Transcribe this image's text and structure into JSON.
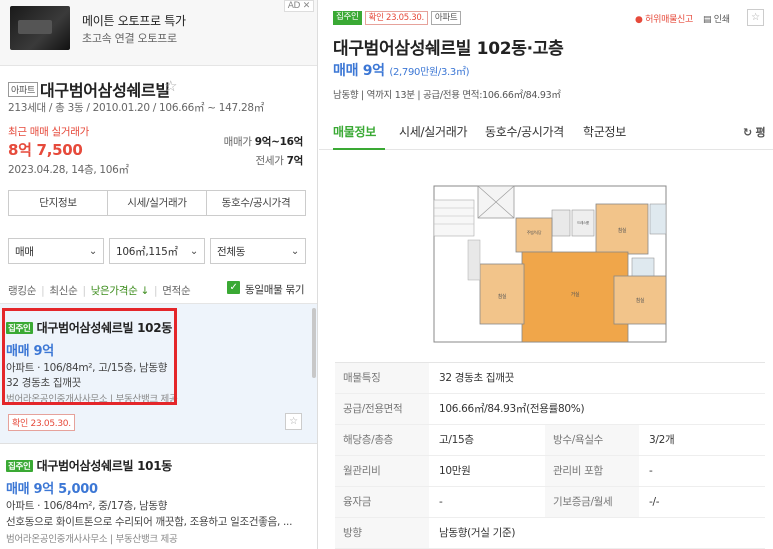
{
  "ad": {
    "title": "메이튼 오토프로 특가",
    "subtitle": "초고속 연결 오토프로",
    "badge": "AD ✕"
  },
  "complex": {
    "type_tag": "아파트",
    "name": "대구범어삼성쉐르빌",
    "star": "☆",
    "info": "213세대 / 총 3동 / 2010.01.20 / 106.66㎡ ~ 147.28㎡",
    "recent_label": "최근 매매 실거래가",
    "recent_price": "8억 7,500",
    "recent_date": "2023.04.28, 14층, 106㎡",
    "sale_label": "매매가",
    "sale_value": "9억~16억",
    "jeonse_label": "전세가",
    "jeonse_value": "7억"
  },
  "complex_buttons": [
    "단지정보",
    "시세/실거래가",
    "동호수/공시가격"
  ],
  "filters": {
    "trade": "매매",
    "area": "106㎡,115㎡",
    "dong": "전체동",
    "chevron": "⌄"
  },
  "sort": {
    "items": [
      "랭킹순",
      "최신순",
      "낮은가격순 ↓",
      "면적순"
    ],
    "same_listing_check": "✓",
    "same_listing_label": "동일매물 묶기"
  },
  "listings": [
    {
      "tag": "집주인",
      "title": "대구범어삼성쉐르빌 102동",
      "price": "매매 9억",
      "spec": "아파트 · 106/84m², 고/15층, 남동향",
      "desc": "32 경동초 집깨끗",
      "broker": "범어라온공인중개사사무소 | 부동산뱅크 제공",
      "confirm": "확인 23.05.30.",
      "fav": "☆"
    },
    {
      "tag": "집주인",
      "title": "대구범어삼성쉐르빌 101동",
      "price": "매매 9억 5,000",
      "spec": "아파트 · 106/84m², 중/17층, 남동향",
      "desc": "선호동으로 화이트톤으로 수리되어 깨끗함, 조용하고 일조건좋음, ...",
      "broker": "범어라온공인중개사사무소 | 부동산뱅크 제공"
    }
  ],
  "detail": {
    "tags": [
      "집주인",
      "확인 23.05.30.",
      "아파트"
    ],
    "report": "허위매물신고",
    "print": "인쇄",
    "fav": "☆",
    "title": "대구범어삼성쉐르빌 102동·고층",
    "price": "매매 9억",
    "price_sub": "(2,790만원/3.3㎡)",
    "info": "남동향 | 역까지 13분 | 공급/전용 면적:106.66㎡/84.93㎡",
    "tabs": [
      "매물정보",
      "시세/실거래가",
      "동호수/공시가격",
      "학군정보"
    ],
    "refresh": "↻ 평",
    "plan_labels": [
      "침실",
      "침실",
      "침실",
      "거실",
      "주방/식당",
      "드레스룸",
      "침실"
    ],
    "table": [
      {
        "k": "매물특징",
        "v": "32 경동초 집깨끗"
      },
      {
        "k": "공급/전용면적",
        "v": "106.66㎡/84.93㎡(전용률80%)"
      },
      {
        "k": "해당층/총층",
        "v": "고/15층",
        "k2": "방수/욕실수",
        "v2": "3/2개"
      },
      {
        "k": "월관리비",
        "v": "10만원",
        "k2": "관리비 포함",
        "v2": "-"
      },
      {
        "k": "융자금",
        "v": "-",
        "k2": "기보증금/월세",
        "v2": "-/-"
      },
      {
        "k": "방향",
        "v": "남동향(거실 기준)"
      }
    ]
  },
  "colors": {
    "green": "#3aa934",
    "red": "#e64a3b",
    "blue": "#3c77d5",
    "highlight_box": "#e4262a"
  }
}
